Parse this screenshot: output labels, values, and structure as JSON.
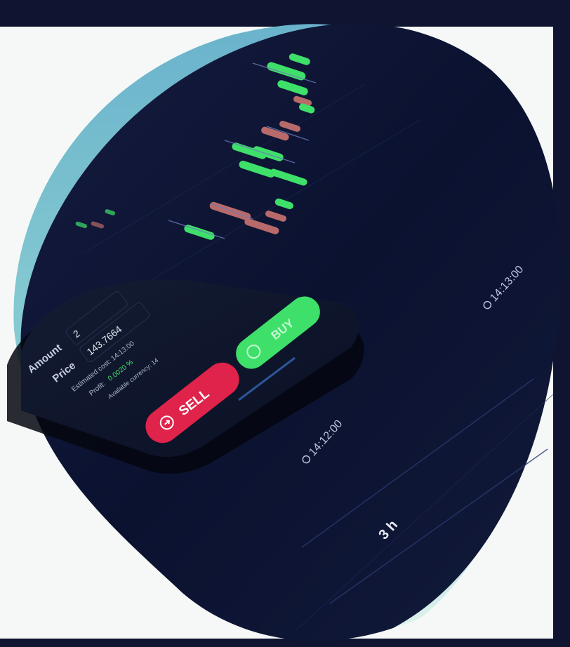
{
  "trade": {
    "amount_label": "Amount",
    "amount_value": "2",
    "price_label": "Price",
    "price_value": "143.7664",
    "estimated_cost": "Estimated cost: 14:13:00",
    "profit_label": "Profit:",
    "profit_value": "0.0020 %",
    "available_currency": "Available currency: 14",
    "sell_label": "SELL",
    "buy_label": "BUY"
  },
  "timeline": {
    "time_1": "14:12:00",
    "time_2": "14:13:00",
    "duration": "3 h"
  },
  "colors": {
    "background": "#f6f8f8",
    "frame": "#0f1530",
    "blob_dark": "#0b1230",
    "blob_teal": "#7fc3cf",
    "up_candle": "#3ee06a",
    "down_candle": "#b86a6a",
    "sell": "#e0234a",
    "buy": "#3ee06a"
  }
}
